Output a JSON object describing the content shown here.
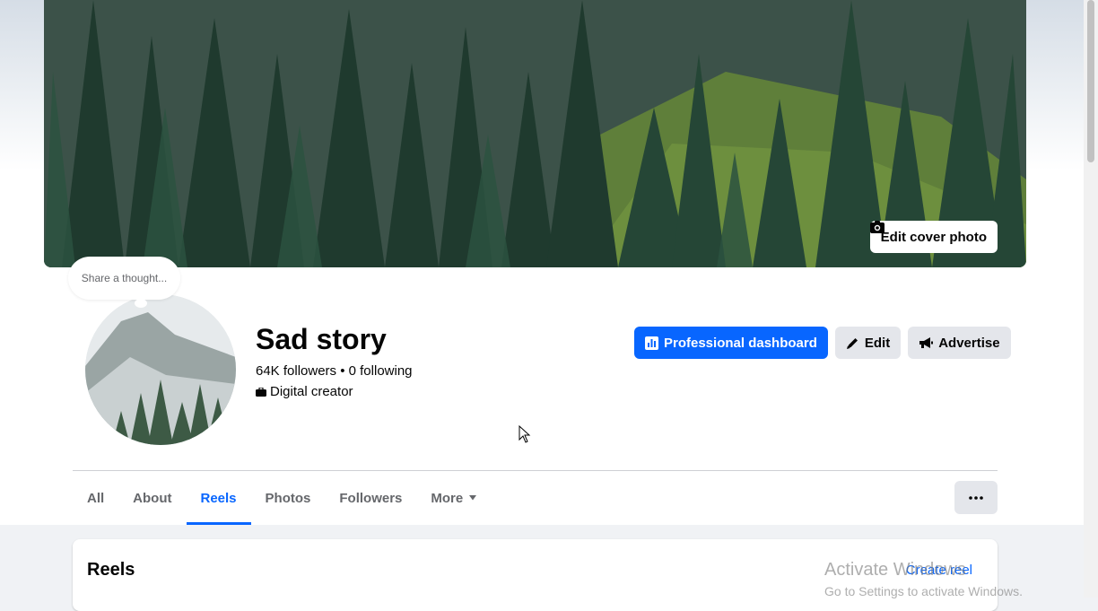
{
  "cover": {
    "edit_button_label": "Edit cover photo",
    "icon": "camera-icon"
  },
  "profile": {
    "thought_placeholder": "Share a thought...",
    "name": "Sad story",
    "stats": "64K followers • 0 following",
    "category": "Digital creator",
    "category_icon": "briefcase-icon"
  },
  "actions": {
    "dashboard_label": "Professional dashboard",
    "edit_label": "Edit",
    "advertise_label": "Advertise"
  },
  "tabs": {
    "items": [
      {
        "label": "All"
      },
      {
        "label": "About"
      },
      {
        "label": "Reels",
        "active": true
      },
      {
        "label": "Photos"
      },
      {
        "label": "Followers"
      },
      {
        "label": "More"
      }
    ]
  },
  "reels_card": {
    "title": "Reels",
    "create_label": "Create reel"
  },
  "watermark": {
    "line1": "Activate Windows",
    "line2": "Go to Settings to activate Windows."
  },
  "colors": {
    "accent": "#0866ff",
    "secondary_button": "#e4e6eb",
    "page_bg": "#f0f2f5"
  }
}
